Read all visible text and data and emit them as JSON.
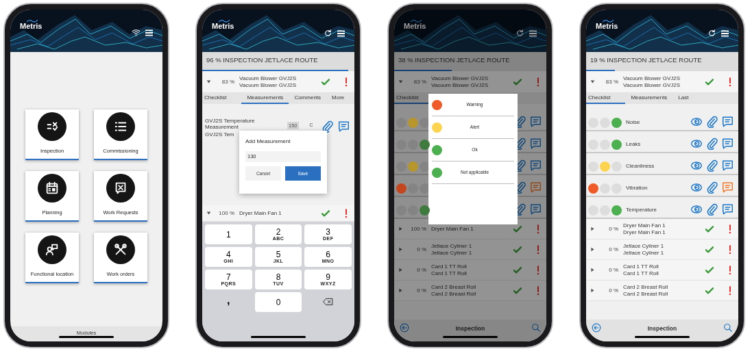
{
  "phones": [
    {
      "kind": "modules",
      "logo": "Metris",
      "modules": [
        {
          "label": "Inspection"
        },
        {
          "label": "Commissioning"
        },
        {
          "label": "Planning"
        },
        {
          "label": "Work Requests"
        },
        {
          "label": "Functional location"
        },
        {
          "label": "Work orders"
        }
      ],
      "footer": "Modules"
    },
    {
      "kind": "measurement",
      "logo": "Metris",
      "route": {
        "title": "96 % INSPECTION JETLACE ROUTE",
        "level": 0.96
      },
      "equipment": {
        "expanded": true,
        "percent": "83 %",
        "name": "Vacuum Blower GVJ2S",
        "subtitle": "Vacuum Blower GVJ2S"
      },
      "tabs": [
        {
          "label": "Checklist",
          "selected": false
        },
        {
          "label": "Measurements",
          "selected": true
        },
        {
          "label": "Comments",
          "selected": false
        },
        {
          "label": "More",
          "selected": false
        }
      ],
      "measurement": {
        "name": "GVJ2S Temperature Measurement",
        "subtitle": "GVJ2S Tem",
        "value": "150",
        "unit": "C"
      },
      "dialog": {
        "title": "Add Measurement",
        "value": "130",
        "buttons": [
          "Cancel",
          "Save"
        ]
      },
      "next_equipment": {
        "expanded": true,
        "percent": "100 %",
        "name": "Dryer Main Fan 1"
      },
      "keyboard": [
        {
          "kind": "digit",
          "digit": "1"
        },
        {
          "kind": "digit",
          "digit": "2",
          "letters": "ABC"
        },
        {
          "kind": "digit",
          "digit": "3",
          "letters": "DEF"
        },
        {
          "kind": "digit",
          "digit": "4",
          "letters": "GHI"
        },
        {
          "kind": "digit",
          "digit": "5",
          "letters": "JKL"
        },
        {
          "kind": "digit",
          "digit": "6",
          "letters": "MNO"
        },
        {
          "kind": "digit",
          "digit": "7",
          "letters": "PQRS"
        },
        {
          "kind": "digit",
          "digit": "8",
          "letters": "TUV"
        },
        {
          "kind": "digit",
          "digit": "9",
          "letters": "WXYZ"
        },
        {
          "kind": "symbol",
          "digit": ","
        },
        {
          "kind": "digit",
          "digit": "0"
        },
        {
          "kind": "delete"
        }
      ]
    },
    {
      "kind": "status_picker",
      "logo": "Metris",
      "route": {
        "title": "38 % INSPECTION JETLACE ROUTE",
        "level": 0.38
      },
      "equipment": {
        "expanded": true,
        "percent": "83 %",
        "name": "Vacuum Blower GVJ2S",
        "subtitle": "Vacuum Blower GVJ2S"
      },
      "tabs": [
        {
          "label": "Checklist",
          "selected": true
        }
      ],
      "checklist": [
        {
          "dots": [
            {
              "selected": false
            },
            {
              "selected": true,
              "color": "#b8962e"
            },
            {
              "selected": false
            }
          ],
          "flagged": false
        },
        {
          "dots": [
            {
              "selected": false
            },
            {
              "selected": false
            },
            {
              "selected": true,
              "color": "#3f7a3f"
            }
          ],
          "flagged": false
        },
        {
          "dots": [
            {
              "selected": false
            },
            {
              "selected": true,
              "color": "#b8962e"
            },
            {
              "selected": false
            }
          ],
          "flagged": false
        },
        {
          "dots": [
            {
              "selected": true,
              "color": "#c4461f"
            },
            {
              "selected": false
            },
            {
              "selected": false
            }
          ],
          "flagged": true
        },
        {
          "dots": [
            {
              "selected": false
            },
            {
              "selected": false
            },
            {
              "selected": true,
              "color": "#3f7a3f"
            }
          ],
          "flagged": false
        }
      ],
      "dialog": {
        "options": [
          {
            "label": "Warning",
            "color": "#f05a28"
          },
          {
            "label": "Alert",
            "color": "#fdd44f"
          },
          {
            "label": "Ok",
            "color": "#4caf50"
          },
          {
            "label": "Not applicable",
            "color": "#4caf50"
          }
        ]
      },
      "equipment_list": [
        {
          "expanded": false,
          "percent": "100 %",
          "subtitle": "Dryer Main Fan 1"
        },
        {
          "expanded": false,
          "percent": "0 %",
          "name": "Jetlace Cyliner 1",
          "subtitle": "Jetlace Cyliner 1"
        },
        {
          "expanded": false,
          "percent": "0 %",
          "name": "Card 1 TT Roll",
          "subtitle": "Card 1 TT Roll"
        },
        {
          "expanded": false,
          "percent": "0 %",
          "name": "Card 2 Breast Roll",
          "subtitle": "Card 2 Breast Roll"
        }
      ],
      "footer": "Inspection"
    },
    {
      "kind": "checklist",
      "logo": "Metris",
      "route": {
        "title": "19 % INSPECTION JETLACE ROUTE",
        "level": 0.19
      },
      "equipment": {
        "expanded": true,
        "percent": "83 %",
        "name": "Vacuum Blower GVJ2S",
        "subtitle": "Vacuum Blower GVJ2S"
      },
      "tabs": [
        {
          "label": "Checklist",
          "selected": true
        },
        {
          "label": "Measurements",
          "selected": false
        },
        {
          "label": "Last",
          "selected": false
        }
      ],
      "checklist": [
        {
          "label": "Noise",
          "dots": [
            {
              "selected": false
            },
            {
              "selected": false
            },
            {
              "selected": true,
              "color": "#4caf50"
            }
          ],
          "flagged": false
        },
        {
          "label": "Leaks",
          "dots": [
            {
              "selected": false
            },
            {
              "selected": false
            },
            {
              "selected": true,
              "color": "#4caf50"
            }
          ],
          "flagged": false
        },
        {
          "label": "Cleanliness",
          "dots": [
            {
              "selected": false
            },
            {
              "selected": true,
              "color": "#fdd44f"
            },
            {
              "selected": false
            }
          ],
          "flagged": false
        },
        {
          "label": "Vibration",
          "dots": [
            {
              "selected": true,
              "color": "#f05a28"
            },
            {
              "selected": false
            },
            {
              "selected": false
            }
          ],
          "flagged": true
        },
        {
          "label": "Temperature",
          "dots": [
            {
              "selected": false
            },
            {
              "selected": false
            },
            {
              "selected": true,
              "color": "#4caf50"
            }
          ],
          "flagged": false
        }
      ],
      "equipment_list": [
        {
          "expanded": false,
          "percent": "0 %",
          "name": "Dryer Main Fan 1",
          "subtitle": "Dryer Main Fan 1"
        },
        {
          "expanded": false,
          "percent": "0 %",
          "name": "Jetlace Cyliner 1",
          "subtitle": "Jetlace Cyliner 1"
        },
        {
          "expanded": false,
          "percent": "0 %",
          "name": "Card 1 TT Roll",
          "subtitle": "Card 1 TT Roll"
        },
        {
          "expanded": false,
          "percent": "0 %",
          "name": "Card 2 Breast Roll",
          "subtitle": "Card 2 Breast Roll"
        }
      ],
      "footer": "Inspection"
    }
  ]
}
